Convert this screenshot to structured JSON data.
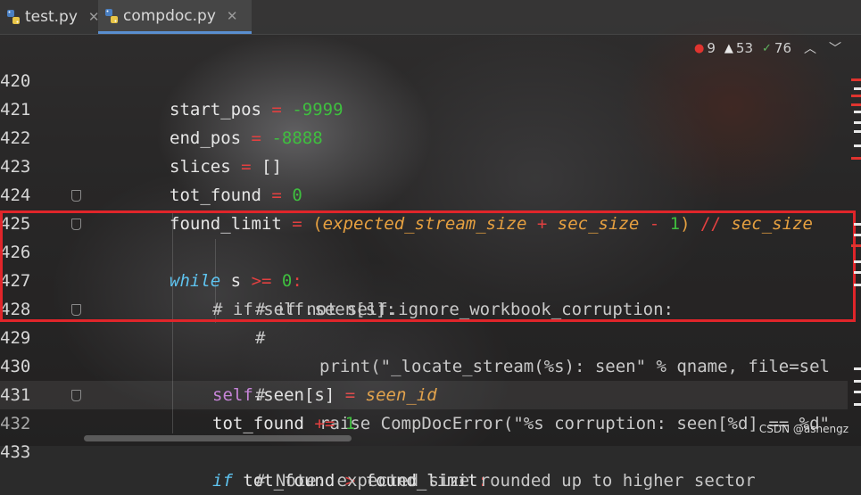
{
  "tabs": [
    {
      "label": "test.py",
      "active": false
    },
    {
      "label": "compdoc.py",
      "active": true
    }
  ],
  "inspections": {
    "errors": "9",
    "warnings": "53",
    "weak_warnings": "76"
  },
  "lines": [
    {
      "n": "420"
    },
    {
      "n": "421"
    },
    {
      "n": "422"
    },
    {
      "n": "423"
    },
    {
      "n": "424"
    },
    {
      "n": "425"
    },
    {
      "n": "426"
    },
    {
      "n": "427"
    },
    {
      "n": "428"
    },
    {
      "n": "429"
    },
    {
      "n": "430"
    },
    {
      "n": "431"
    },
    {
      "n": "432"
    },
    {
      "n": "433"
    }
  ],
  "code": {
    "l420": {
      "a": "start_pos",
      "b": "=",
      "c": "-9999"
    },
    "l421": {
      "a": "end_pos",
      "b": "=",
      "c": "-8888"
    },
    "l422": {
      "a": "slices",
      "b": "=",
      "c": "[]"
    },
    "l423": {
      "a": "tot_found",
      "b": "=",
      "c": "0"
    },
    "l424": {
      "a": "found_limit",
      "b": "=",
      "c": "(",
      "d": "expected_stream_size",
      "e": "+",
      "f": "sec_size",
      "g": "-",
      "h": "1",
      "i": ")",
      "j": "//",
      "k": "sec_size"
    },
    "l425": {
      "a": "while",
      "b": "s",
      "c": ">=",
      "d": "0",
      "e": ":"
    },
    "l426": {
      "a": "# if self.seen[s]:"
    },
    "l427": {
      "a": "# if not self.ignore_workbook_corruption:"
    },
    "l428": {
      "a": "#",
      "b": "print(\"_locate_stream(%s): seen\" % qname, file=sel"
    },
    "l429": {
      "a": "#",
      "b": "raise CompDocError(\"%s corruption: seen[%d] == %d\""
    },
    "l430": {
      "a": "self",
      "b": ".seen[s]",
      "c": "=",
      "d": "seen_id"
    },
    "l431": {
      "a": "tot_found",
      "b": "+=",
      "c": "1"
    },
    "l432": {
      "a": "if",
      "b": "tot_found",
      "c": ">",
      "d": "found_limit",
      "e": ":"
    },
    "l433": {
      "a": "# Note: expected size rounded up to higher sector"
    }
  },
  "watermark": "CSDN @ashengz",
  "colors": {
    "highlight_box": "#e0252a",
    "error": "#e0342f",
    "active_tab": "#5a8fd0"
  }
}
